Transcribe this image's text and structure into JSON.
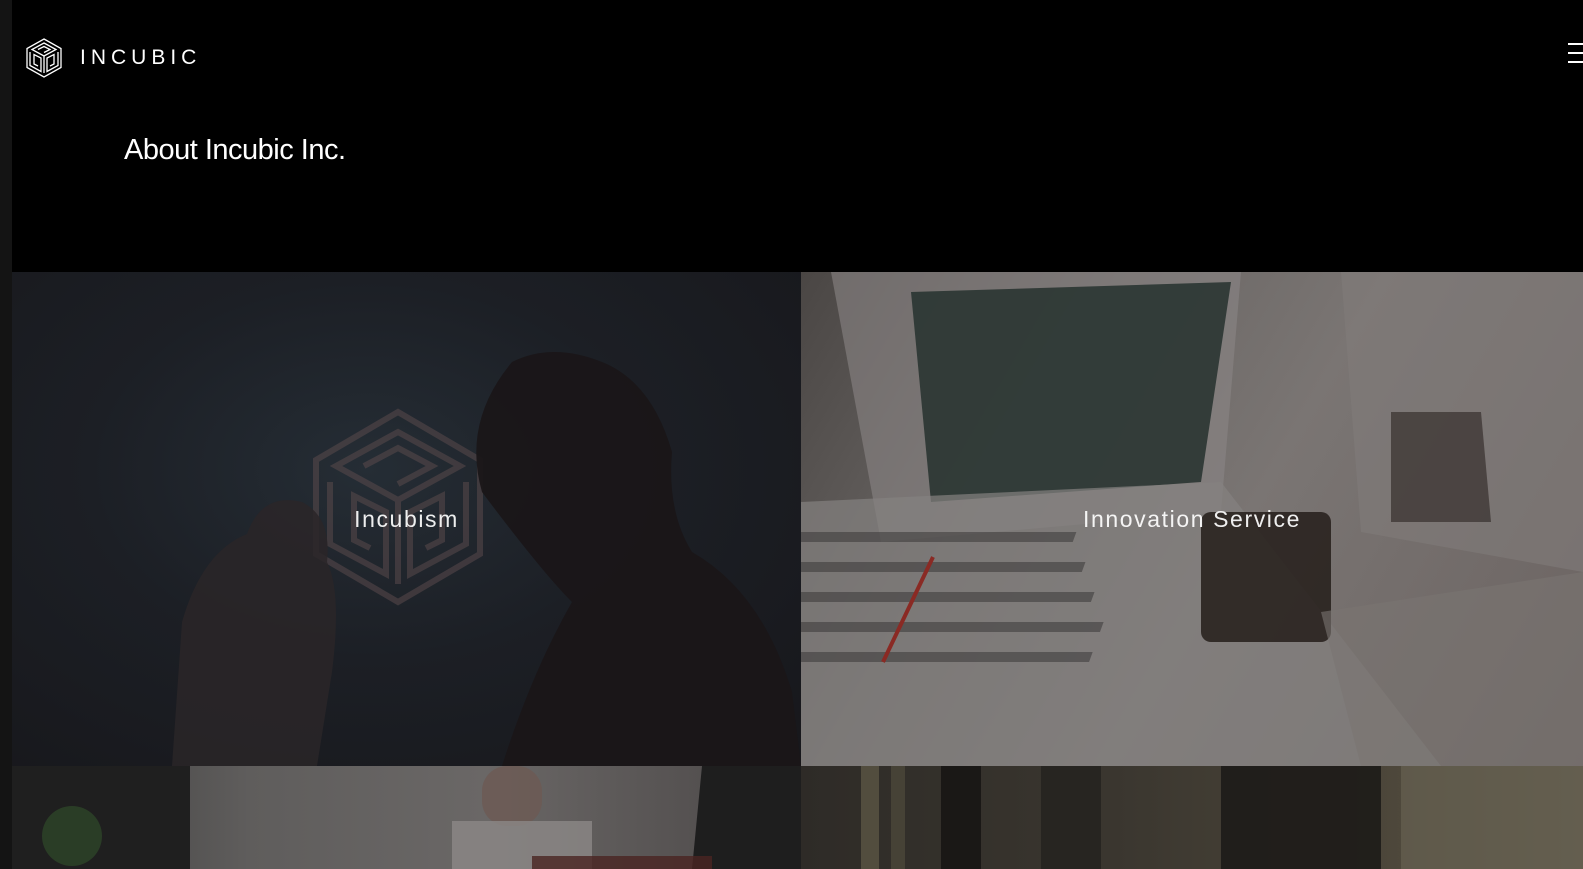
{
  "header": {
    "logo_text": "INCUBIC",
    "logo_icon": "cube-maze-icon",
    "menu_icon": "hamburger-menu-icon"
  },
  "main": {
    "title": "About Incubic Inc."
  },
  "tiles": [
    {
      "label": "Incubism"
    },
    {
      "label": "Innovation Service"
    },
    {
      "label": ""
    },
    {
      "label": ""
    }
  ],
  "colors": {
    "background": "#000000",
    "text": "#ffffff"
  }
}
